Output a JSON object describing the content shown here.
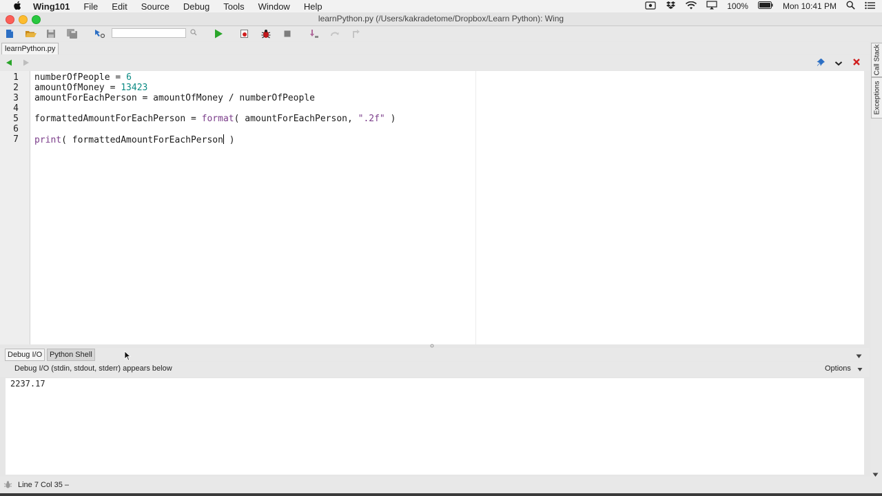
{
  "menubar": {
    "app_name": "Wing101",
    "items": [
      "File",
      "Edit",
      "Source",
      "Debug",
      "Tools",
      "Window",
      "Help"
    ],
    "battery": "100%",
    "clock": "Mon 10:41 PM"
  },
  "window": {
    "title": "learnPython.py (/Users/kakradetome/Dropbox/Learn Python): Wing"
  },
  "toolbar": {
    "search_value": ""
  },
  "editor": {
    "tab_label": "learnPython.py",
    "lines": [
      {
        "n": "1",
        "text": "numberOfPeople = 6"
      },
      {
        "n": "2",
        "text": "amountOfMoney = 13423"
      },
      {
        "n": "3",
        "text": "amountForEachPerson = amountOfMoney / numberOfPeople"
      },
      {
        "n": "4",
        "text": ""
      },
      {
        "n": "5",
        "text": "formattedAmountForEachPerson = format( amountForEachPerson, \".2f\" )"
      },
      {
        "n": "6",
        "text": ""
      },
      {
        "n": "7",
        "text": "print( formattedAmountForEachPerson )"
      }
    ]
  },
  "side_tabs": [
    "Call Stack",
    "Exceptions"
  ],
  "bottom_panel": {
    "tabs": [
      "Debug I/O",
      "Python Shell"
    ],
    "active_tab": "Debug I/O",
    "header": "Debug I/O (stdin, stdout, stderr) appears below",
    "options_label": "Options",
    "output": "2237.17"
  },
  "statusbar": {
    "text": "Line 7 Col 35 –"
  },
  "colors": {
    "number": "#0b8a83",
    "builtin": "#7b3d8a",
    "run_green": "#2aa52a",
    "close_red": "#d01f1f"
  }
}
